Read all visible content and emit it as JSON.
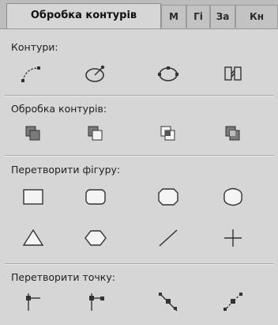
{
  "tabs": [
    {
      "label": "Обробка контурів",
      "active": true
    },
    {
      "label": "М",
      "active": false
    },
    {
      "label": "Гі",
      "active": false
    },
    {
      "label": "За",
      "active": false
    },
    {
      "label": "Кн",
      "active": false
    }
  ],
  "sections": {
    "paths": {
      "label": "Контури:",
      "tools": [
        "curve-path-icon",
        "ellipse-direction-icon",
        "closed-path-points-icon",
        "reverse-path-icon"
      ]
    },
    "path_processing": {
      "label": "Обробка контурів:",
      "tools": [
        "union-icon",
        "subtract-front-icon",
        "intersect-icon",
        "exclude-overlap-icon"
      ]
    },
    "transform_shape": {
      "label": "Перетворити фігуру:",
      "tools_row1": [
        "rectangle-icon",
        "rounded-rectangle-icon",
        "octagon-icon",
        "scalloped-shape-icon"
      ],
      "tools_row2": [
        "triangle-icon",
        "hexagon-icon",
        "line-icon",
        "cross-icon"
      ]
    },
    "transform_point": {
      "label": "Перетворити точку:",
      "tools": [
        "corner-point-icon",
        "smooth-point-icon",
        "symmetric-point-icon",
        "asymmetric-point-icon"
      ]
    }
  },
  "colors": {
    "panel_bg": "#d6d6d6",
    "tab_strip": "#bdbdbd",
    "icon_stroke": "#333333",
    "icon_fill_dark": "#6e6e6e",
    "icon_fill_light": "#f4f4f4"
  }
}
